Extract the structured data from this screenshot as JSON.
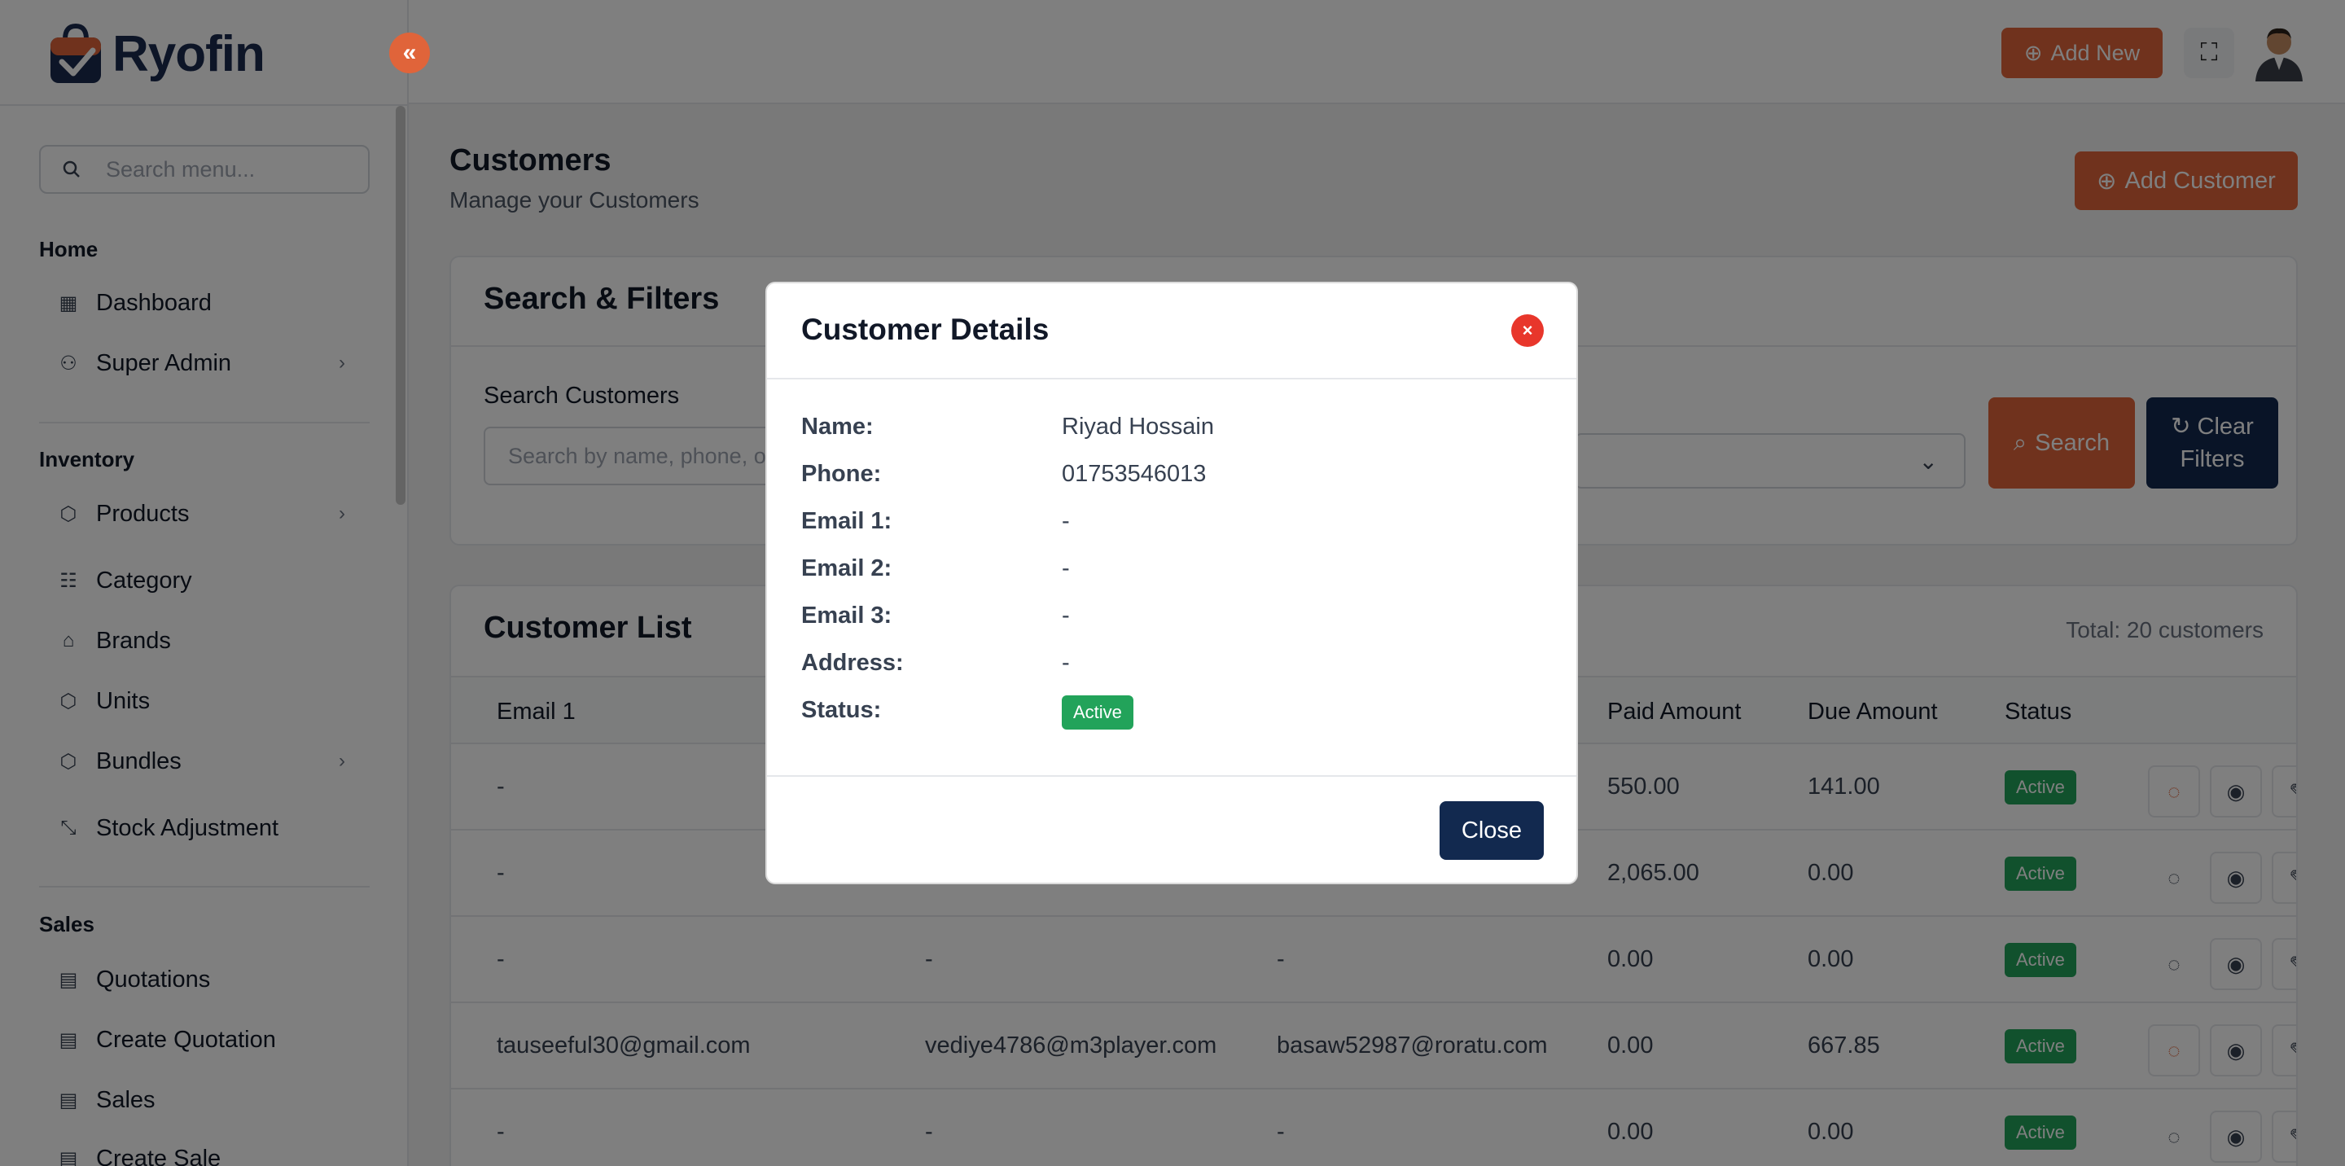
{
  "app": {
    "logo_text": "Ryofin"
  },
  "sidebar": {
    "search_placeholder": "Search menu...",
    "sections": {
      "home": "Home",
      "inventory": "Inventory",
      "sales": "Sales"
    },
    "items": {
      "dashboard": "Dashboard",
      "super_admin": "Super Admin",
      "products": "Products",
      "category": "Category",
      "brands": "Brands",
      "units": "Units",
      "bundles": "Bundles",
      "stock_adjustment": "Stock Adjustment",
      "quotations": "Quotations",
      "create_quotation": "Create Quotation",
      "sales": "Sales",
      "create_sale": "Create Sale"
    }
  },
  "header": {
    "add_new_label": "Add New"
  },
  "page": {
    "title": "Customers",
    "subtitle": "Manage your Customers",
    "add_customer_label": "Add Customer"
  },
  "filters": {
    "title": "Search & Filters",
    "search_label": "Search Customers",
    "search_placeholder": "Search by name, phone, or e",
    "search_button": "Search",
    "clear_button_line1": "Clear",
    "clear_button_line2": "Filters"
  },
  "list": {
    "title": "Customer List",
    "total": "Total: 20 customers",
    "columns": {
      "email1": "Email 1",
      "paid": "Paid Amount",
      "due": "Due Amount",
      "status": "Status"
    },
    "rows": [
      {
        "email1": "-",
        "email2": "",
        "email3": "",
        "paid": "550.00",
        "due": "141.00",
        "status": "Active"
      },
      {
        "email1": "-",
        "email2": "",
        "email3": "",
        "paid": "2,065.00",
        "due": "0.00",
        "status": "Active"
      },
      {
        "email1": "-",
        "email2": "-",
        "email3": "-",
        "paid": "0.00",
        "due": "0.00",
        "status": "Active"
      },
      {
        "email1": "tauseeful30@gmail.com",
        "email2": "vediye4786@m3player.com",
        "email3": "basaw52987@roratu.com",
        "paid": "0.00",
        "due": "667.85",
        "status": "Active"
      },
      {
        "email1": "-",
        "email2": "-",
        "email3": "-",
        "paid": "0.00",
        "due": "0.00",
        "status": "Active"
      }
    ]
  },
  "modal": {
    "title": "Customer Details",
    "labels": {
      "name": "Name:",
      "phone": "Phone:",
      "email1": "Email 1:",
      "email2": "Email 2:",
      "email3": "Email 3:",
      "address": "Address:",
      "status": "Status:"
    },
    "values": {
      "name": "Riyad Hossain",
      "phone": "01753546013",
      "email1": "-",
      "email2": "-",
      "email3": "-",
      "address": "-",
      "status": "Active"
    },
    "close_label": "Close"
  },
  "colors": {
    "accent": "#e0643a",
    "navy": "#12294f",
    "success": "#22a35a",
    "danger": "#e8362b"
  }
}
